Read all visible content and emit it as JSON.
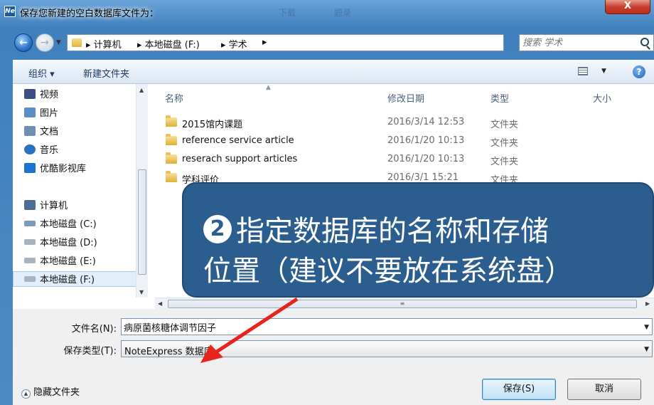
{
  "window": {
    "title": "保存您新建的空白数据库文件为：",
    "ghost_texts": [
      "下载",
      "题录"
    ],
    "close_label": "X"
  },
  "nav": {
    "back_glyph": "←",
    "forward_glyph": "→",
    "breadcrumbs": [
      "▸ 计算机",
      "▸ 本地磁盘 (F:)",
      "▸ 学术",
      "▸"
    ],
    "search_placeholder": "搜索 学术"
  },
  "toolbar": {
    "organize_label": "组织 ▾",
    "new_folder_label": "新建文件夹",
    "help_label": "?"
  },
  "sidebar": {
    "items": [
      {
        "label": "视频",
        "icon": "video-icon",
        "color": "#3a4f86"
      },
      {
        "label": "图片",
        "icon": "pictures-icon",
        "color": "#5a8fc8"
      },
      {
        "label": "文档",
        "icon": "documents-icon",
        "color": "#6f8fb5"
      },
      {
        "label": "音乐",
        "icon": "music-icon",
        "color": "#2b6fbf"
      },
      {
        "label": "优酷影视库",
        "icon": "youku-icon",
        "color": "#1b74d1"
      },
      {
        "label": "计算机",
        "icon": "computer-icon",
        "color": "#4c6c92"
      },
      {
        "label": "本地磁盘 (C:)",
        "icon": "drive-c-icon",
        "color": "#7b9abc"
      },
      {
        "label": "本地磁盘 (D:)",
        "icon": "drive-d-icon",
        "color": "#a7b3c1"
      },
      {
        "label": "本地磁盘 (E:)",
        "icon": "drive-e-icon",
        "color": "#a7b3c1"
      },
      {
        "label": "本地磁盘 (F:)",
        "icon": "drive-f-icon",
        "color": "#a7b3c1"
      }
    ]
  },
  "file_list": {
    "columns": [
      "名称",
      "修改日期",
      "类型",
      "大小"
    ],
    "rows": [
      {
        "name": "2015馆内课题",
        "date": "2016/3/14 12:53",
        "type": "文件夹"
      },
      {
        "name": "reference service article",
        "date": "2016/1/20 10:13",
        "type": "文件夹"
      },
      {
        "name": "reserach support articles",
        "date": "2016/1/20 10:13",
        "type": "文件夹"
      },
      {
        "name": "学科评价",
        "date": "2016/3/1 15:21",
        "type": "文件夹"
      }
    ]
  },
  "form": {
    "filename_label": "文件名(N):",
    "filename_value": "病原菌核糖体调节因子",
    "filetype_label": "保存类型(T):",
    "filetype_value": "NoteExpress 数据库"
  },
  "footer": {
    "hide_folders_label": "隐藏文件夹",
    "save_label": "保存(S)",
    "cancel_label": "取消"
  },
  "callout": {
    "number": "2",
    "line1": "指定数据库的名称和存储",
    "line2": "位置（建议不要放在系统盘）",
    "bg_color": "#2c5d8f",
    "arrow_color": "#e8231c"
  }
}
